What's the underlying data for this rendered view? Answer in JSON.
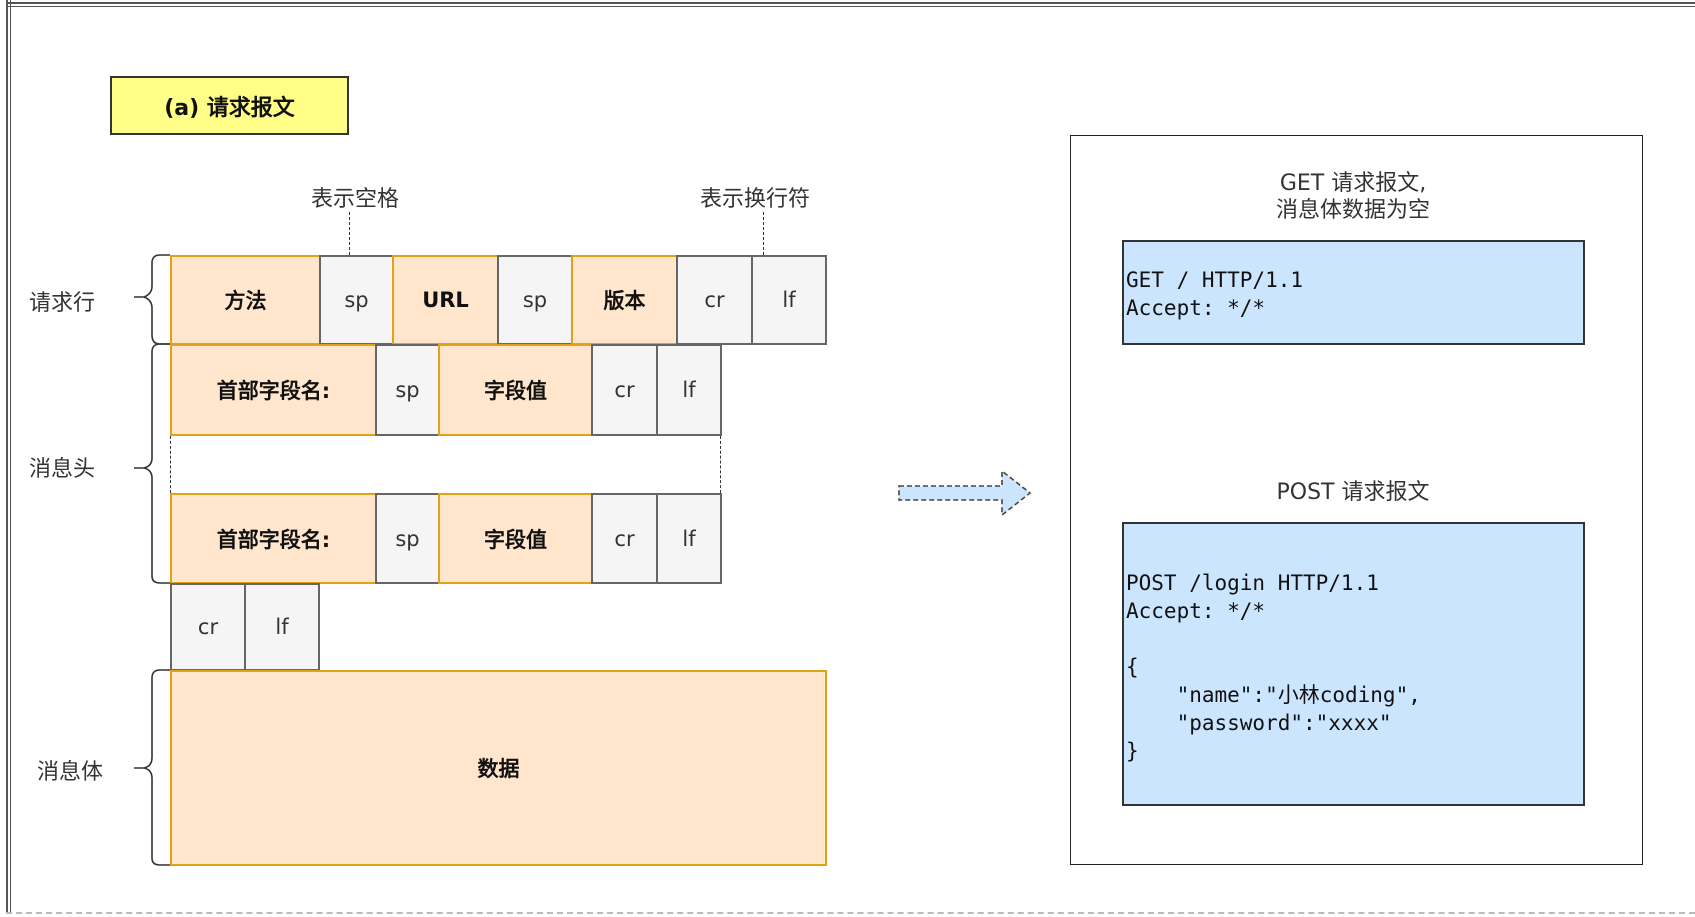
{
  "title": "(a) 请求报文",
  "annotations": {
    "space": "表示空格",
    "newline": "表示换行符"
  },
  "sections": {
    "request_line": "请求行",
    "header": "消息头",
    "body": "消息体"
  },
  "request_line_cells": [
    {
      "label": "方法",
      "kind": "field"
    },
    {
      "label": "sp",
      "kind": "control"
    },
    {
      "label": "URL",
      "kind": "field"
    },
    {
      "label": "sp",
      "kind": "control"
    },
    {
      "label": "版本",
      "kind": "field"
    },
    {
      "label": "cr",
      "kind": "control"
    },
    {
      "label": "lf",
      "kind": "control"
    }
  ],
  "header_rows": [
    [
      {
        "label": "首部字段名:",
        "kind": "field"
      },
      {
        "label": "sp",
        "kind": "control"
      },
      {
        "label": "字段值",
        "kind": "field"
      },
      {
        "label": "cr",
        "kind": "control"
      },
      {
        "label": "lf",
        "kind": "control"
      }
    ],
    [
      {
        "label": "首部字段名:",
        "kind": "field"
      },
      {
        "label": "sp",
        "kind": "control"
      },
      {
        "label": "字段值",
        "kind": "field"
      },
      {
        "label": "cr",
        "kind": "control"
      },
      {
        "label": "lf",
        "kind": "control"
      }
    ]
  ],
  "blank_line_cells": [
    {
      "label": "cr",
      "kind": "control"
    },
    {
      "label": "lf",
      "kind": "control"
    }
  ],
  "body_cell": {
    "label": "数据",
    "kind": "field"
  },
  "examples": {
    "get": {
      "caption_line1": "GET 请求报文,",
      "caption_line2": "消息体数据为空",
      "code": "GET / HTTP/1.1\nAccept: */*"
    },
    "post": {
      "caption": "POST 请求报文",
      "code": "POST /login HTTP/1.1\nAccept: */*\n\n{\n    \"name\":\"小林coding\",\n    \"password\":\"xxxx\"\n}"
    }
  },
  "colors": {
    "field_fill": "#ffe6cc",
    "field_stroke": "#e0a317",
    "control_fill": "#f5f5f5",
    "control_stroke": "#666666",
    "title_fill": "#ffff88",
    "code_fill": "#cce5ff"
  }
}
